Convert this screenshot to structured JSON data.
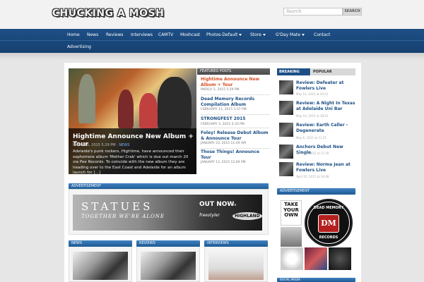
{
  "site": {
    "logo": "CHUCKING A MOSH",
    "search_placeholder": "Search",
    "search_button": "SEARCH"
  },
  "nav": {
    "items": [
      {
        "label": "Home"
      },
      {
        "label": "News"
      },
      {
        "label": "Reviews"
      },
      {
        "label": "Interviews"
      },
      {
        "label": "CAMTV"
      },
      {
        "label": "Moshcast"
      },
      {
        "label": "Photos-Default"
      },
      {
        "label": "Store"
      },
      {
        "label": "G'Day Mate"
      },
      {
        "label": "Contact"
      },
      {
        "label": "Advertising"
      }
    ]
  },
  "feature": {
    "title": "Hightime Announce New Album + Tour",
    "date": "MARCH 5, 2015 5:29 PM",
    "category": "NEWS",
    "excerpt": "Adelaide's punk rockers, Hightime, have announced their sophomore album 'Mother Crab' which is due out march 20 via Pee Records. To coincide with the new album they are heading over to the East Coast and Adelaide for an album launch for [...]"
  },
  "featured_posts": {
    "heading": "FEATURED POSTS",
    "items": [
      {
        "title": "Hightime Announce New Album + Tour",
        "date": "MARCH 5, 2015 5:29 PM"
      },
      {
        "title": "Dead Memory Records Compilation Album",
        "date": "FEBRUARY 11, 2015 3:37 PM"
      },
      {
        "title": "STRONGFEST 2015",
        "date": "FEBRUARY 3, 2015 4:33 PM"
      },
      {
        "title": "Foley! Release Debut Album & Announce Tour",
        "date": "JANUARY 23, 2015 11:49 AM"
      },
      {
        "title": "Those Things! Announce Tour",
        "date": "JANUARY 13, 2015 12:09 PM"
      }
    ]
  },
  "sidebar": {
    "tab_breaking": "BREAKING NEWS",
    "tab_popular": "POPULAR",
    "breaking": [
      {
        "title": "Review: Defeater at Fowlers Live",
        "date": "May 14, 2015 at 20:41"
      },
      {
        "title": "Review: A Night In Texas at Adelaide Uni Bar",
        "date": "May 10, 2015 at 18:41"
      },
      {
        "title": "Review: Earth Caller - Degenerate",
        "date": "May 6, 2015 at 11:25"
      },
      {
        "title": "Anchors Debut New Single",
        "date": "April 28, 2015 at 17:39"
      },
      {
        "title": "Review: Norma Jean at Fowlers Live",
        "date": "April 20, 2015 at 16:48"
      }
    ],
    "advertisement_heading": "ADVERTISEMENT",
    "take_own": "TAKE YOUR OWN",
    "dm_top": "DEAD MEMORY",
    "dm_bottom": "RECORDS",
    "dm_badge": "DM",
    "social_heading": "SOCIAL MEDIA"
  },
  "advert": {
    "heading": "ADVERTISEMENT",
    "title": "STATUES",
    "subtitle": "TOGETHER WE'RE ALONE",
    "out_now": "OUT NOW",
    "via": "via",
    "label1": "freestyler",
    "label2": "HIGHLAND"
  },
  "sections": {
    "news": "NEWS",
    "reviews": "REVIEWS",
    "interviews": "INTERVIEWS"
  }
}
